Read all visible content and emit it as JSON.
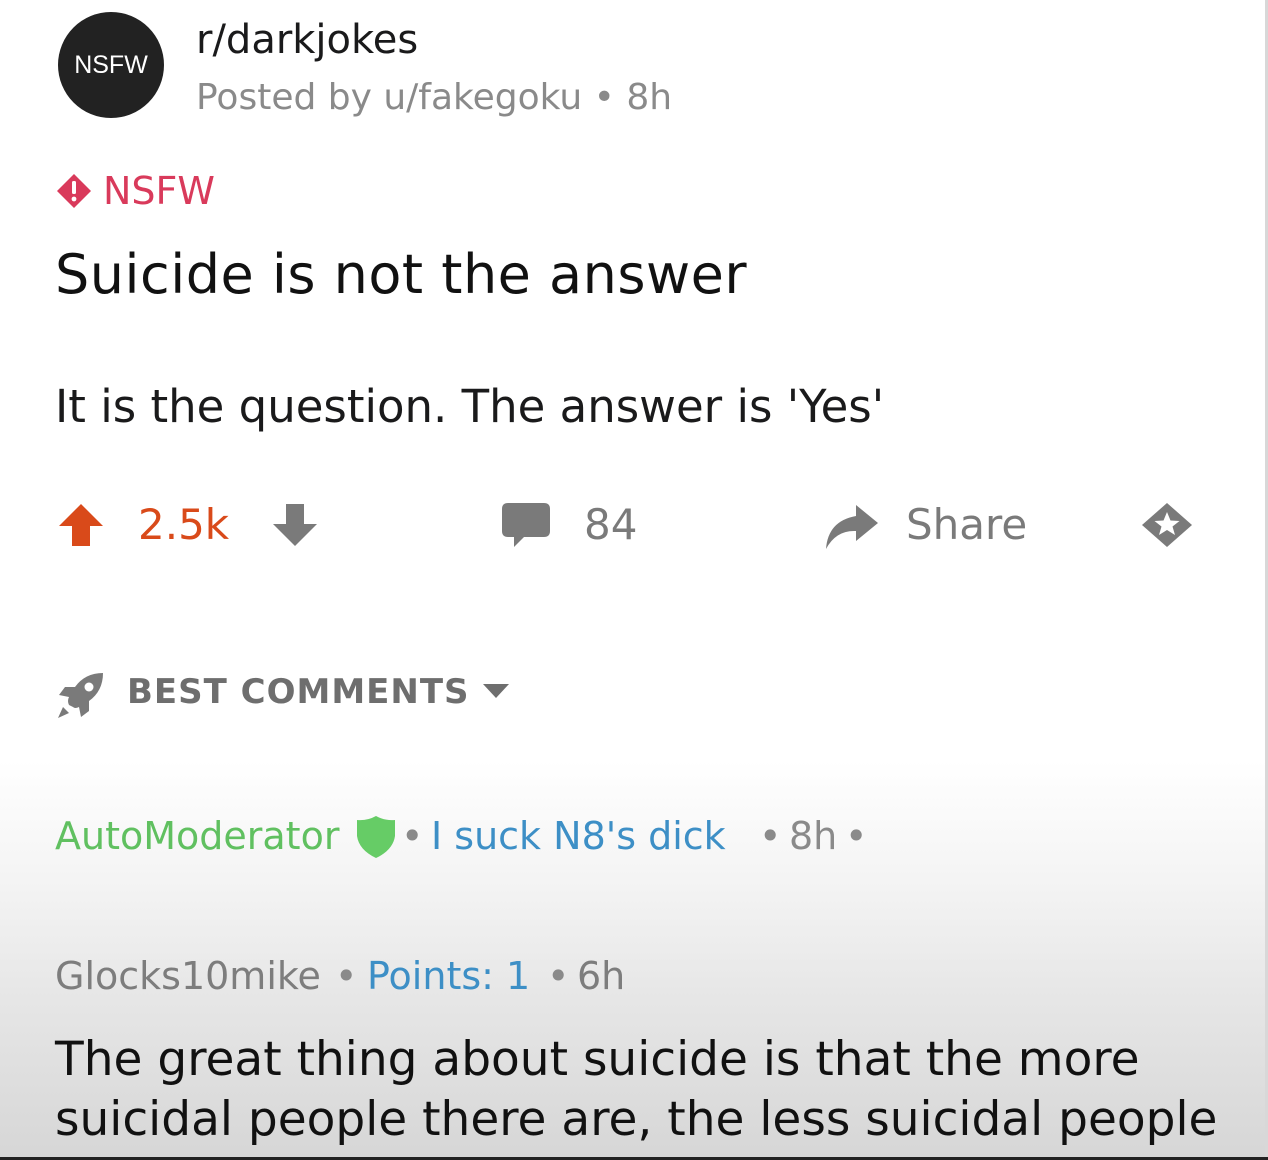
{
  "post": {
    "avatar_text": "NSFW",
    "subreddit": "r/darkjokes",
    "posted_by": "Posted by u/fakegoku",
    "separator": "•",
    "age": "8h",
    "nsfw_tag": "NSFW",
    "title": "Suicide is not the answer",
    "body": "It is the question. The answer is 'Yes'",
    "score": "2.5k",
    "comment_count": "84",
    "share_label": "Share",
    "icons": {
      "upvote": "upvote-arrow-icon",
      "downvote": "downvote-arrow-icon",
      "comments": "speech-bubble-icon",
      "share": "share-arrow-icon",
      "award": "award-star-icon",
      "nsfw": "warning-diamond-icon"
    }
  },
  "sort": {
    "label": "BEST COMMENTS",
    "icon": "rocket-icon"
  },
  "comments": [
    {
      "author": "AutoModerator",
      "badge_icon": "moderator-shield-icon",
      "flair": "I suck N8's dick",
      "age": "8h",
      "separator": "•"
    },
    {
      "author": "Glocks10mike",
      "points": "Points: 1",
      "age": "6h",
      "separator": "•",
      "body_lines": [
        "The great thing about suicide is that the more",
        "suicidal people there are, the less suicidal people"
      ]
    }
  ],
  "colors": {
    "upvote_active": "#d94a1a",
    "nsfw": "#d93a5b",
    "moderator": "#60c060",
    "flair": "#3d8fc6",
    "muted": "#8a8a8a"
  }
}
